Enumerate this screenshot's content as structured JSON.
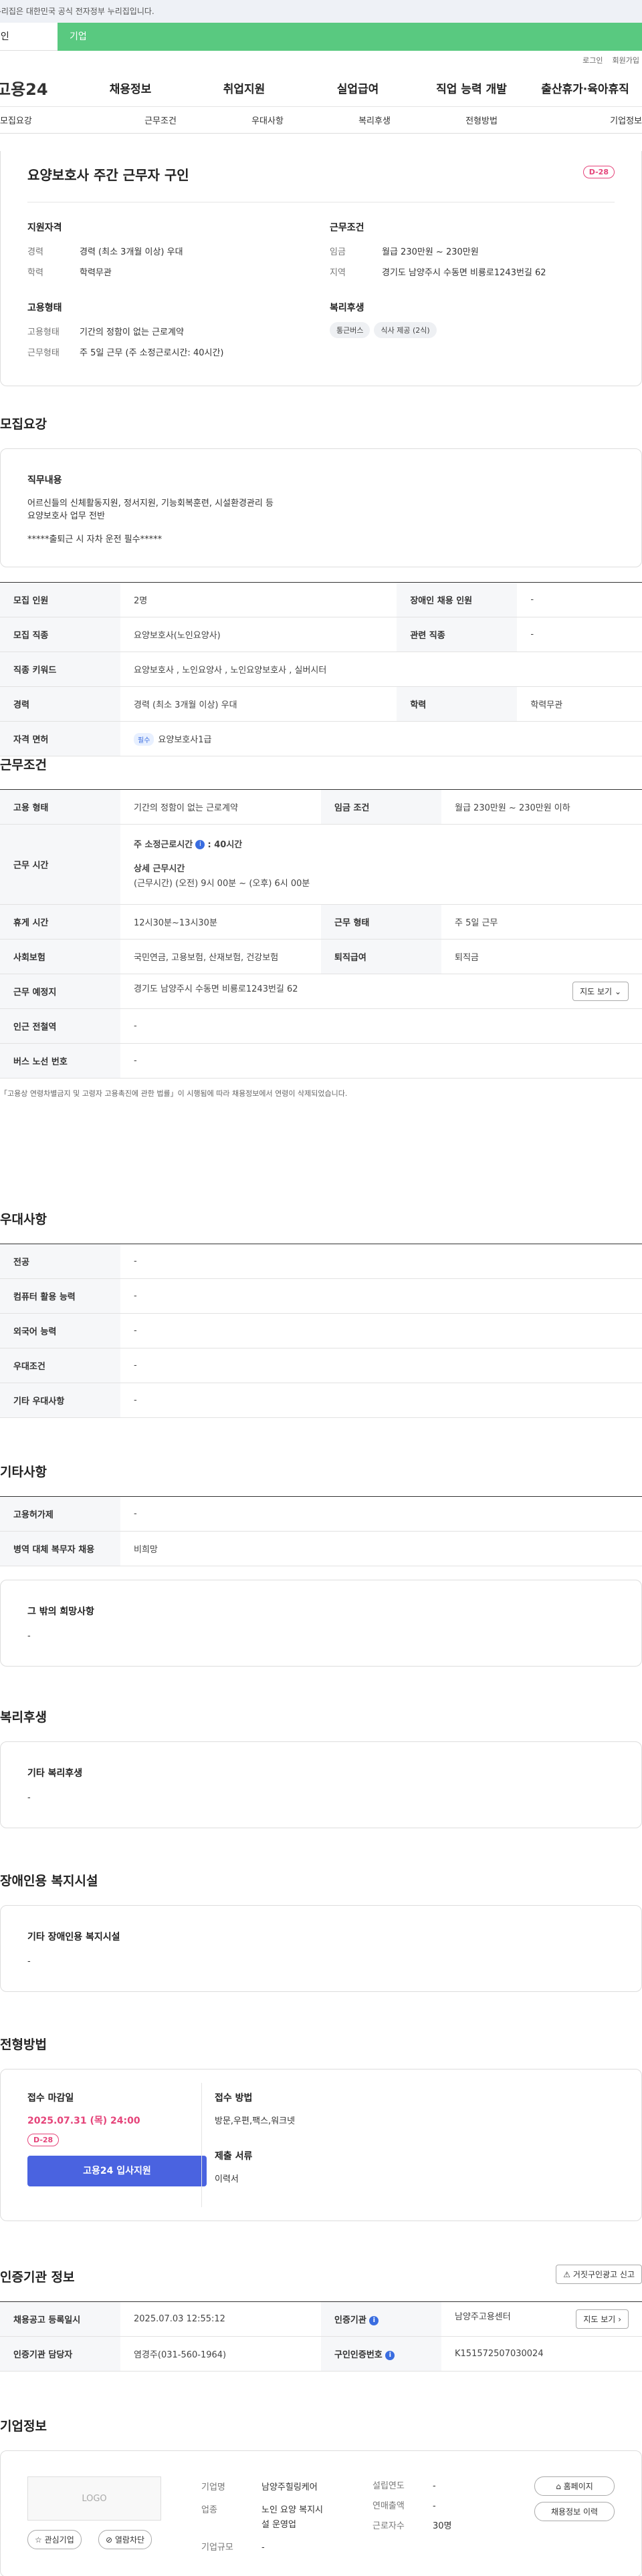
{
  "notice": "이 누리집은 대한민국 공식 전자정부 누리집입니다.",
  "usertabs": [
    "개인",
    "기업"
  ],
  "toplinks": [
    "로그인",
    "회원가입"
  ],
  "logo": "고용24",
  "gnb": [
    "채용정보",
    "취업지원",
    "실업급여",
    "직업 능력 개발",
    "출산휴가·육아휴직"
  ],
  "subnav": [
    "모집요강",
    "근무조건",
    "우대사항",
    "복리후생",
    "전형방법",
    "기업정보"
  ],
  "summary": {
    "title": "요양보호사 주간 근무자 구인",
    "dday": "D-28",
    "qual_h": "지원자격",
    "career_l": "경력",
    "career_v": "경력 (최소 3개월 이상) 우대",
    "edu_l": "학력",
    "edu_v": "학력무관",
    "emp_h": "고용형태",
    "emp_l": "고용형태",
    "emp_v": "기간의 정함이 없는 근로계약",
    "wt_l": "근무형태",
    "wt_v": "주 5일 근무 (주 소정근로시간: 40시간)",
    "cond_h": "근무조건",
    "wage_l": "임금",
    "wage_v": "월급 230만원 ~ 230만원",
    "region_l": "지역",
    "region_v": "경기도 남양주시 수동면 비룡로1243번길 62",
    "wel_h": "복리후생",
    "wel_tags": [
      "통근버스",
      "식사 제공 (2식)"
    ]
  },
  "recruit": {
    "h": "모집요강",
    "duty_h": "직무내용",
    "duty_1": "어르신들의 신체활동지원, 정서지원, 기능회복훈련, 시설환경관리 등",
    "duty_2": "요양보호사 업무 전반",
    "duty_3": "*****출퇴근 시 자차 운전 필수*****",
    "r1": [
      "모집 인원",
      "2명",
      "장애인 채용 인원",
      "-"
    ],
    "r2": [
      "모집 직종",
      "요양보호사(노인요양사)",
      "관련 직종",
      "-"
    ],
    "r3": [
      "직종 키워드",
      "요양보호사 , 노인요양사 , 노인요양보호사 , 실버시터"
    ],
    "r4": [
      "경력",
      "경력 (최소 3개월 이상) 우대",
      "학력",
      "학력무관"
    ],
    "r5": [
      "자격 면허",
      "필수",
      "요양보호사1급"
    ]
  },
  "work": {
    "h": "근무조건",
    "r1": [
      "고용 형태",
      "기간의 정함이 없는 근로계약",
      "임금 조건",
      "월급 230만원 ~ 230만원 이하"
    ],
    "r2_l": "근무 시간",
    "r2_a": "주 소정근로시간",
    "r2_b": ": 40시간",
    "r2_c": "상세 근무시간",
    "r2_d": "(근무시간) (오전) 9시 00분 ~ (오후) 6시 00분",
    "r3": [
      "휴게 시간",
      "12시30분~13시30분",
      "근무 형태",
      "주 5일 근무"
    ],
    "r4": [
      "사회보험",
      "국민연금, 고용보험, 산재보험, 건강보험",
      "퇴직급여",
      "퇴직금"
    ],
    "r5": [
      "근무 예정지",
      "경기도 남양주시 수동면 비룡로1243번길 62",
      "지도 보기"
    ],
    "r6": [
      "인근 전철역",
      "-"
    ],
    "r7": [
      "버스 노선 번호",
      "-"
    ],
    "footnote": "「고용상 연령차별금지 및 고령자 고용촉진에 관한 법률」이 시행됨에 따라 채용정보에서 연령이 삭제되었습니다."
  },
  "pref": {
    "h": "우대사항",
    "rows": [
      [
        "전공",
        "-"
      ],
      [
        "컴퓨터 활용 능력",
        "-"
      ],
      [
        "외국어 능력",
        "-"
      ],
      [
        "우대조건",
        "-"
      ],
      [
        "기타 우대사항",
        "-"
      ]
    ]
  },
  "etc": {
    "h": "기타사항",
    "rows": [
      [
        "고용허가제",
        "-"
      ],
      [
        "병역 대체 복무자 채용",
        "비희망"
      ]
    ],
    "hope_h": "그 밖의 희망사항",
    "hope_v": "-"
  },
  "welfare": {
    "h": "복리후생",
    "sub": "기타 복리후생",
    "v": "-"
  },
  "disab": {
    "h": "장애인용 복지시설",
    "sub": "기타 장애인용 복지시설",
    "v": "-"
  },
  "process": {
    "h": "전형방법",
    "deadline_h": "접수 마감일",
    "deadline_v": "2025.07.31 (목) 24:00",
    "dday": "D-28",
    "apply": "고용24 입사지원",
    "method_h": "접수 방법",
    "method_v": "방문,우편,팩스,워크넷",
    "docs_h": "제출 서류",
    "docs_v": "이력서"
  },
  "agency": {
    "h": "인증기관 정보",
    "report": "거짓구인광고 신고",
    "r1": [
      "채용공고 등록일시",
      "2025.07.03 12:55:12",
      "인증기관",
      "남양주고용센터",
      "지도 보기"
    ],
    "r2": [
      "인증기관 담당자",
      "염경주(031-560-1964)",
      "구인인증번호",
      "K151572507030024"
    ]
  },
  "company": {
    "h": "기업정보",
    "logo": "LOGO",
    "fav": "관심기업",
    "block": "열람차단",
    "name_l": "기업명",
    "name_v": "남양주힐링케어",
    "ind_l": "업종",
    "ind_v1": "노인 요양 복지시",
    "ind_v2": "설 운영업",
    "size_l": "기업규모",
    "size_v": "-",
    "est_l": "설립연도",
    "est_v": "-",
    "sales_l": "연매출액",
    "sales_v": "-",
    "emp_l": "근로자수",
    "emp_v": "30명",
    "home": "홈페이지",
    "history": "채용정보 이력"
  }
}
